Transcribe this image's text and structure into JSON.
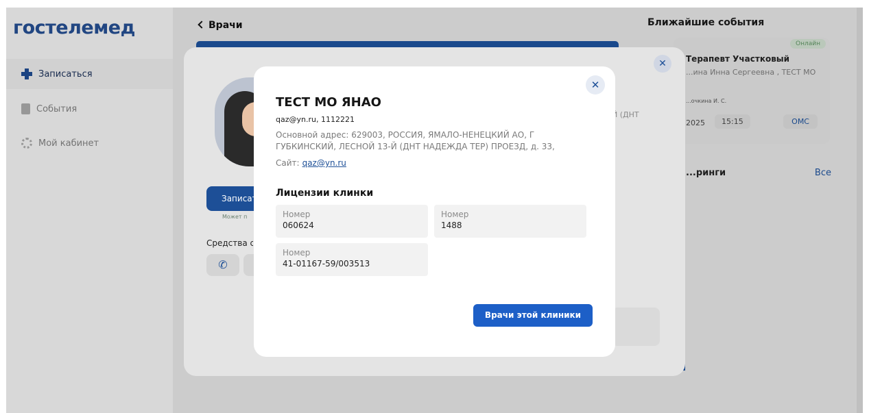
{
  "app": {
    "logo": "гостелемед"
  },
  "sidebar": {
    "items": [
      {
        "label": "Записаться",
        "icon": "plus-icon",
        "active": true
      },
      {
        "label": "События",
        "icon": "document-icon",
        "active": false
      },
      {
        "label": "Мой кабинет",
        "icon": "gear-icon",
        "active": false
      }
    ]
  },
  "header": {
    "back_label": "Врачи"
  },
  "right_panel": {
    "title": "Ближайшие события",
    "event": {
      "badge": "Онлайн",
      "specialty": "Терапевт Участковый",
      "doctor": "...ина Инна Сергеевна , ТЕСТ МО",
      "doctor_short": "...очкина И. С.",
      "date": "2025",
      "time": "15:15",
      "payment": "ОМС"
    },
    "screenings_title": "...ринги",
    "screenings_all": "Все"
  },
  "doctor_modal": {
    "book_button": "Записат",
    "book_hint": "Может п",
    "contacts_title": "Средства с",
    "side_text": "Й (ДНТ"
  },
  "clinic_modal": {
    "name": "ТЕСТ МО ЯНАО",
    "contact": "qaz@yn.ru, 1112221",
    "address": "Основной адрес: 629003, РОССИЯ, ЯМАЛО-НЕНЕЦКИЙ АО, Г ГУБКИНСКИЙ, ЛЕСНОЙ 13-Й (ДНТ НАДЕЖДА ТЕР) ПРОЕЗД, д. 33,",
    "site_label": "Сайт:",
    "site_link": "qaz@yn.ru",
    "licenses_title": "Лицензии клинки",
    "licenses": [
      {
        "label": "Номер",
        "value": "060624"
      },
      {
        "label": "Номер",
        "value": "1488"
      },
      {
        "label": "Номер",
        "value": "41-01167-59/003513"
      }
    ],
    "doctors_button": "Врачи этой клиники"
  },
  "colors": {
    "brand": "#244c8c",
    "accent": "#1d5fc7"
  }
}
